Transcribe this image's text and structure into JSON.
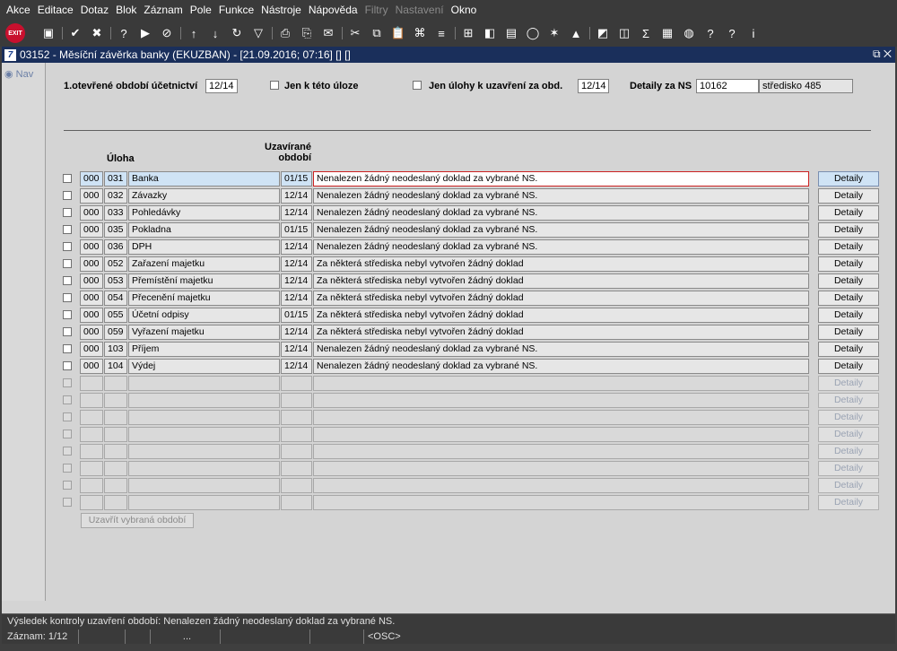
{
  "menu": [
    {
      "label": "Akce",
      "disabled": false
    },
    {
      "label": "Editace",
      "disabled": false
    },
    {
      "label": "Dotaz",
      "disabled": false
    },
    {
      "label": "Blok",
      "disabled": false
    },
    {
      "label": "Záznam",
      "disabled": false
    },
    {
      "label": "Pole",
      "disabled": false
    },
    {
      "label": "Funkce",
      "disabled": false
    },
    {
      "label": "Nástroje",
      "disabled": false
    },
    {
      "label": "Nápověda",
      "disabled": false
    },
    {
      "label": "Filtry",
      "disabled": true
    },
    {
      "label": "Nastavení",
      "disabled": true
    },
    {
      "label": "Okno",
      "disabled": false
    }
  ],
  "toolbar": {
    "exit_label": "EXIT",
    "buttons": [
      "save-icon",
      "commit-icon",
      "delete-icon",
      "query-icon",
      "execute-query-icon",
      "cancel-query-icon",
      "sort-asc-icon",
      "sort-desc-icon",
      "refresh-icon",
      "filter-icon",
      "print-icon",
      "print-preview-icon",
      "mail-icon",
      "cut-icon",
      "copy-icon",
      "paste-icon",
      "attach-icon",
      "list-icon",
      "tree-icon",
      "record-icon",
      "document-icon",
      "globe-icon",
      "star-icon",
      "alert-icon",
      "chart-icon",
      "graph-icon",
      "sum-icon",
      "excel-icon",
      "web-icon",
      "help-icon",
      "whatsthis-icon",
      "info-icon"
    ]
  },
  "window": {
    "title": "03152 - Měsíční závěrka banky (EKUZBAN) - [21.09.2016; 07:16] [] []",
    "icon_text": "7",
    "controls": "⧉ ✕"
  },
  "nav": {
    "label": "Nav"
  },
  "form": {
    "period_label": "1.otevřené období účetnictví",
    "period_value": "12/14",
    "only_task_label": "Jen k této úloze",
    "only_close_label": "Jen úlohy k uzavření za obd.",
    "close_period_value": "12/14",
    "ns_label": "Detaily za NS",
    "ns_value": "10162",
    "ns_desc": "středisko 485"
  },
  "table": {
    "col_task": "Úloha",
    "col_period": "Uzavírané období",
    "detail_label": "Detaily",
    "rows": [
      {
        "a": "000",
        "code": "031",
        "name": "Banka",
        "period": "01/15",
        "msg": "Nenalezen žádný neodeslaný doklad za vybrané NS."
      },
      {
        "a": "000",
        "code": "032",
        "name": "Závazky",
        "period": "12/14",
        "msg": "Nenalezen žádný neodeslaný doklad za vybrané NS."
      },
      {
        "a": "000",
        "code": "033",
        "name": "Pohledávky",
        "period": "12/14",
        "msg": "Nenalezen žádný neodeslaný doklad za vybrané NS."
      },
      {
        "a": "000",
        "code": "035",
        "name": "Pokladna",
        "period": "01/15",
        "msg": "Nenalezen žádný neodeslaný doklad za vybrané NS."
      },
      {
        "a": "000",
        "code": "036",
        "name": "DPH",
        "period": "12/14",
        "msg": "Nenalezen žádný neodeslaný doklad za vybrané NS."
      },
      {
        "a": "000",
        "code": "052",
        "name": "Zařazení majetku",
        "period": "12/14",
        "msg": "Za některá střediska nebyl vytvořen žádný doklad"
      },
      {
        "a": "000",
        "code": "053",
        "name": "Přemístění majetku",
        "period": "12/14",
        "msg": "Za některá střediska nebyl vytvořen žádný doklad"
      },
      {
        "a": "000",
        "code": "054",
        "name": "Přecenění majetku",
        "period": "12/14",
        "msg": "Za některá střediska nebyl vytvořen žádný doklad"
      },
      {
        "a": "000",
        "code": "055",
        "name": "Účetní odpisy",
        "period": "01/15",
        "msg": "Za některá střediska nebyl vytvořen žádný doklad"
      },
      {
        "a": "000",
        "code": "059",
        "name": "Vyřazení majetku",
        "period": "12/14",
        "msg": "Za některá střediska nebyl vytvořen žádný doklad"
      },
      {
        "a": "000",
        "code": "103",
        "name": "Příjem",
        "period": "12/14",
        "msg": "Nenalezen žádný neodeslaný doklad za vybrané NS."
      },
      {
        "a": "000",
        "code": "104",
        "name": "Výdej",
        "period": "12/14",
        "msg": "Nenalezen žádný neodeslaný doklad za vybrané NS."
      }
    ],
    "empty_rows": 8
  },
  "close_button_label": "Uzavřít vybraná období",
  "message": "Výsledek kontroly uzavření období: Nenalezen žádný neodeslaný doklad za vybrané NS.",
  "status": {
    "record": "Záznam: 1/12",
    "mid": "...",
    "mode": "<OSC>"
  }
}
